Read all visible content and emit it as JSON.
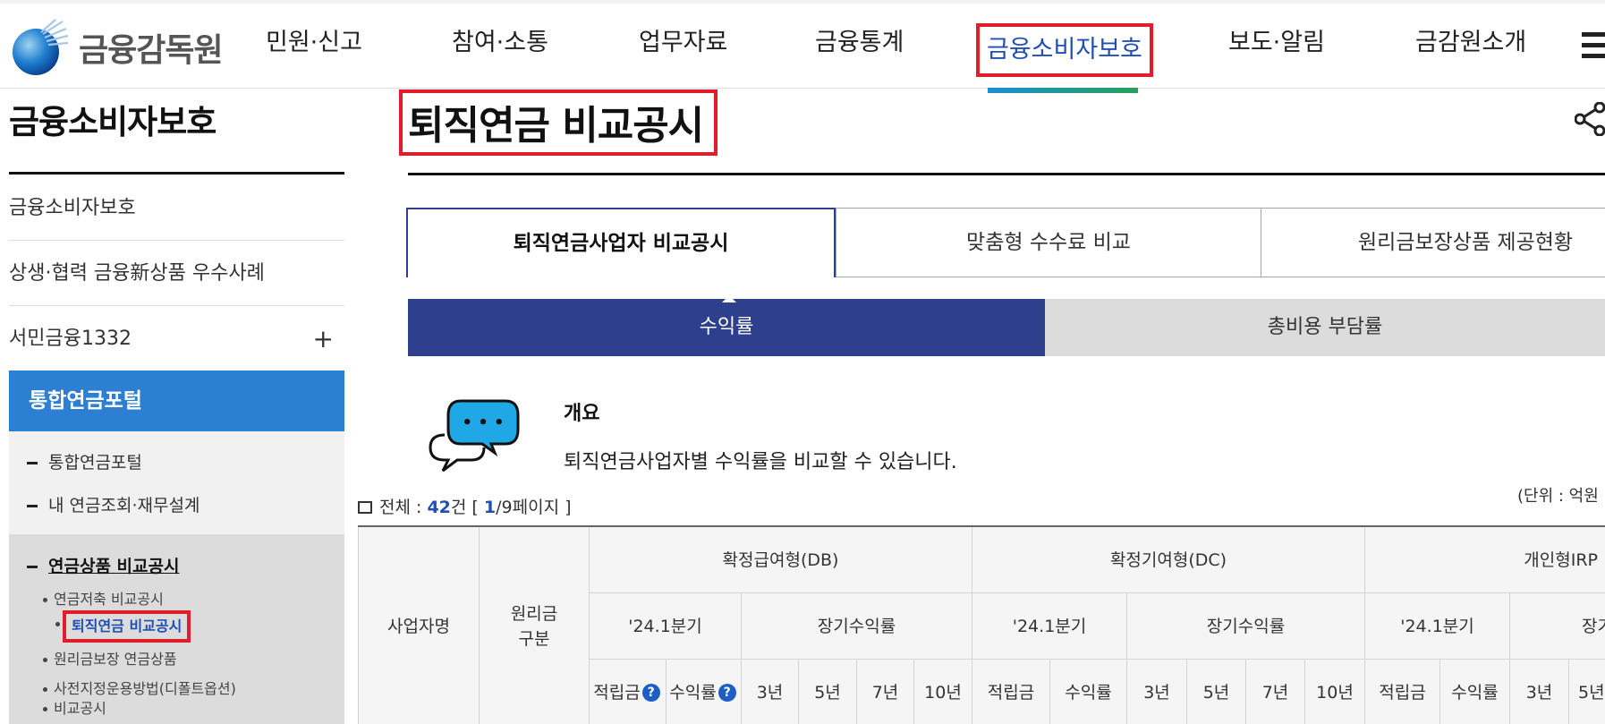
{
  "header": {
    "logo_text": "금융감독원",
    "gnb": [
      "민원·신고",
      "참여·소통",
      "업무자료",
      "금융통계",
      "금융소비자보호",
      "보도·알림",
      "금감원소개"
    ],
    "active_gnb": "금융소비자보호"
  },
  "sidebar": {
    "title": "금융소비자보호",
    "links": [
      "금융소비자보호",
      "상생·협력 금융新상품 우수사례",
      "서민금융1332"
    ],
    "plus": "+",
    "section": "통합연금포털",
    "sub_items": [
      "통합연금포털",
      "내 연금조회·재무설계",
      "연금상품 비교공시"
    ],
    "sub_sub_items": [
      "연금저축 비교공시",
      "퇴직연금 비교공시",
      "원리금보장 연금상품",
      "사전지정운용방법(디폴트옵션)",
      "비교공시"
    ]
  },
  "main": {
    "title": "퇴직연금 비교공시",
    "tabs": [
      "퇴직연금사업자 비교공시",
      "맞춤형 수수료 비교",
      "원리금보장상품 제공현황"
    ],
    "subtabs": [
      "수익률",
      "총비용 부담률"
    ],
    "overview_title": "개요",
    "overview_desc": "퇴직연금사업자별 수익률을 비교할 수 있습니다.",
    "total_label": "전체 : ",
    "total_count": "42",
    "total_unit": "건 [ ",
    "page_current": "1",
    "page_rest": "/9페이지 ]",
    "unit_text": "(단위 : 억원",
    "bubble_dots": "• • •"
  },
  "table": {
    "h_company": "사업자명",
    "h_principal_1": "원리금",
    "h_principal_2": "구분",
    "groups": [
      "확정급여형(DB)",
      "확정기여형(DC)",
      "개인형IRP"
    ],
    "quarter": "'24.1분기",
    "long_term": "장기수익률",
    "long_term_partial": "장기",
    "reserve": "적립금",
    "yield": "수익률",
    "years": [
      "3년",
      "5년",
      "7년",
      "10년"
    ],
    "help": "?"
  },
  "colors": {
    "accent_blue": "#2e3f8e",
    "link_blue": "#1f4fb5",
    "highlight_red": "#e11d2b",
    "sidebar_blue": "#2d7fd3"
  }
}
